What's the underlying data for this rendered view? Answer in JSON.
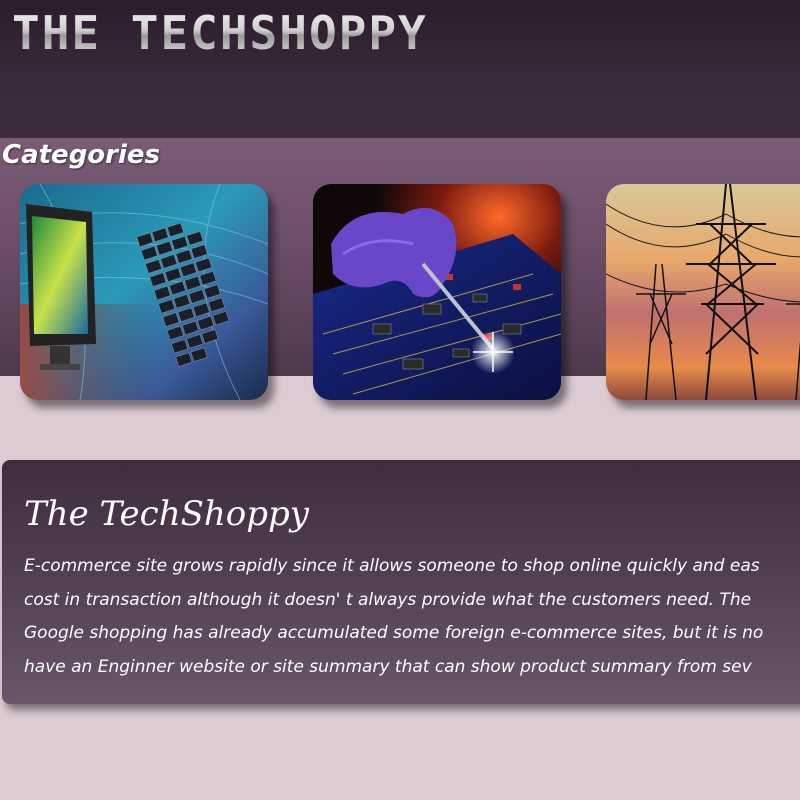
{
  "header": {
    "logo_text": "THE TECHSHOPPY"
  },
  "categories": {
    "title": "Categories",
    "items": [
      {
        "image": "computer-monitor-keyboard-image"
      },
      {
        "image": "circuit-board-soldering-image"
      },
      {
        "image": "power-transmission-towers-image"
      }
    ]
  },
  "about": {
    "title": "The TechShoppy",
    "lines": [
      "E-commerce site grows rapidly since it allows someone to shop online quickly and eas",
      "cost in transaction although it doesn' t always provide what the customers need. The",
      "Google shopping has already accumulated some foreign e-commerce sites, but it is no",
      "have an Enginner website or site summary that can show product summary from sev"
    ]
  },
  "colors": {
    "header_bg": "#2b1d2b",
    "band_bg": "#6b4e68",
    "page_bg": "#dccbd3",
    "panel_bg": "#4f3b4f"
  }
}
